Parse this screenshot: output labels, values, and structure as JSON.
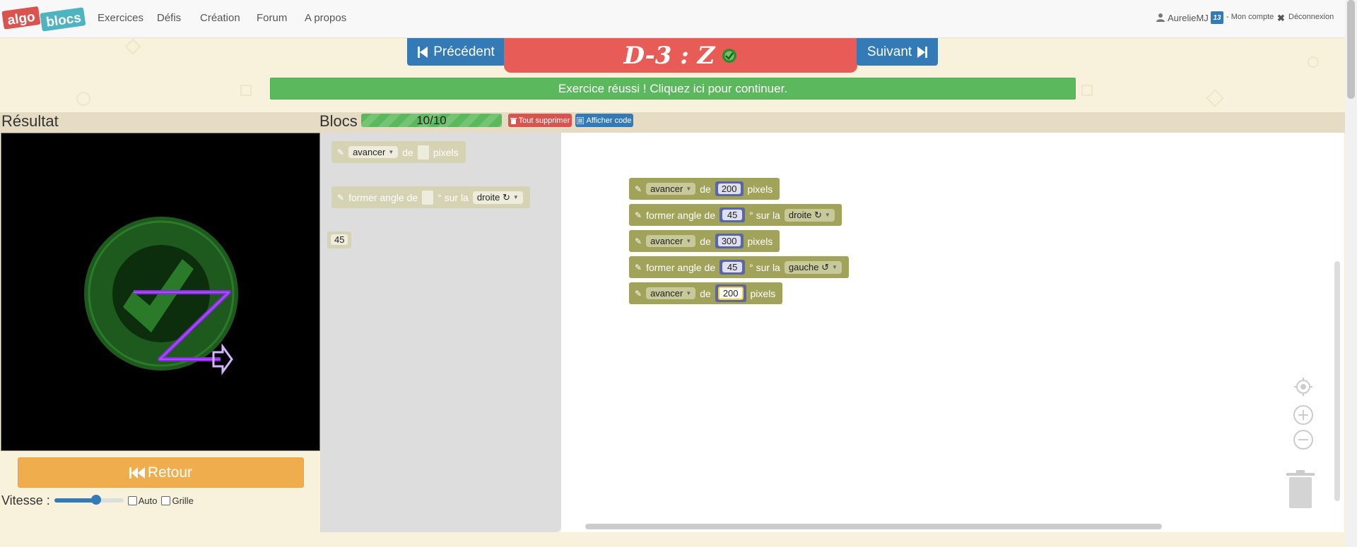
{
  "nav": {
    "logo_left": "algo",
    "logo_right": "blocs",
    "links": [
      "Exercices",
      "Défis",
      "Création",
      "Forum",
      "A propos"
    ],
    "user": "AurelieMJ",
    "user_badge": "13",
    "account": "- Mon compte",
    "logout": "Déconnexion"
  },
  "exercise": {
    "prev": "Précédent",
    "title": "D-3 : Z",
    "next": "Suivant",
    "success_message": "Exercice réussi ! Cliquez ici pour continuer."
  },
  "result_panel": {
    "title": "Résultat",
    "back": "Retour",
    "speed_label": "Vitesse :",
    "speed_value": 0.6,
    "auto": "Auto",
    "grid": "Grille"
  },
  "blocks_panel": {
    "title": "Blocs",
    "progress": "10/10",
    "delete_all": "Tout supprimer",
    "show_code": "Afficher code"
  },
  "toolbox": {
    "move": {
      "action": "avancer",
      "de": "de",
      "unit": "pixels"
    },
    "turn": {
      "label": "former angle de",
      "sur": "° sur la",
      "dir": "droite ↻"
    },
    "number": "45"
  },
  "program": [
    {
      "type": "move",
      "action": "avancer",
      "de": "de",
      "value": "200",
      "unit": "pixels"
    },
    {
      "type": "turn",
      "label": "former angle de",
      "value": "45",
      "sur": "° sur la",
      "dir": "droite ↻"
    },
    {
      "type": "move",
      "action": "avancer",
      "de": "de",
      "value": "300",
      "unit": "pixels"
    },
    {
      "type": "turn",
      "label": "former angle de",
      "value": "45",
      "sur": "° sur la",
      "dir": "gauche ↺"
    },
    {
      "type": "move",
      "action": "avancer",
      "de": "de",
      "value": "200",
      "unit": "pixels"
    }
  ],
  "colors": {
    "primary": "#337ab7",
    "success": "#5cb85c",
    "danger": "#d9534f",
    "warning": "#f0ad4e",
    "title_bg": "#e85c57",
    "block": "#a0a359",
    "number_socket": "#5b67a5",
    "path": "#8a2be2"
  }
}
